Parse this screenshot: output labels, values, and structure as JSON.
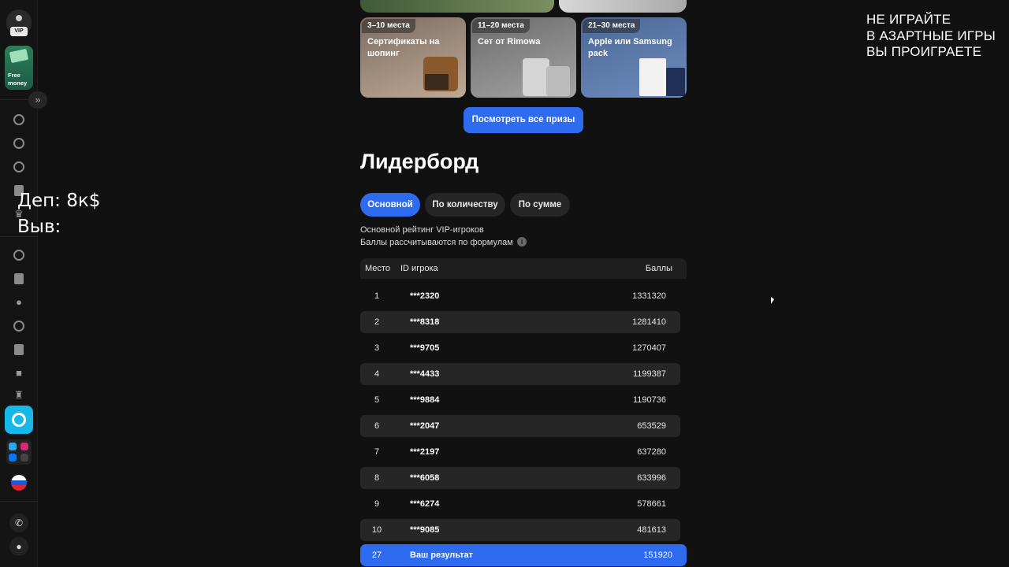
{
  "sidebar": {
    "vip_badge": "VIP",
    "free_money_label": "Free money",
    "icons": [
      "casino-chip-icon",
      "football-icon",
      "coins-icon",
      "gift-icon",
      "crown-icon",
      "compass-icon",
      "document-icon",
      "chat-icon",
      "chart-icon",
      "news-icon",
      "gamepad-icon",
      "trophy-icon",
      "app-icon",
      "social-icon",
      "flag-ru-icon",
      "phone-icon",
      "support-chat-icon"
    ]
  },
  "overlay": {
    "dep_line": "Деп: 8к$",
    "vyv_line": "Выв:",
    "warning_line1": "НЕ ИГРАЙТЕ",
    "warning_line2": "В АЗАРТНЫЕ ИГРЫ",
    "warning_line3": "ВЫ ПРОИГРАЕТЕ"
  },
  "prizes": [
    {
      "badge": "3–10 места",
      "title": "Сертификаты на шопинг"
    },
    {
      "badge": "11–20 места",
      "title": "Сет от Rimowa"
    },
    {
      "badge": "21–30 места",
      "title": "Apple или Samsung pack"
    }
  ],
  "see_all_button": "Посмотреть все призы",
  "leaderboard": {
    "title": "Лидерборд",
    "tabs": [
      "Основной",
      "По количеству",
      "По сумме"
    ],
    "active_tab": "Основной",
    "desc_line1": "Основной рейтинг VIP-игроков",
    "desc_line2": "Баллы рассчитываются по формулам",
    "columns": {
      "place": "Место",
      "id": "ID игрока",
      "points": "Баллы"
    },
    "rows": [
      {
        "place": "1",
        "id": "***2320",
        "points": "1331320"
      },
      {
        "place": "2",
        "id": "***8318",
        "points": "1281410"
      },
      {
        "place": "3",
        "id": "***9705",
        "points": "1270407"
      },
      {
        "place": "4",
        "id": "***4433",
        "points": "1199387"
      },
      {
        "place": "5",
        "id": "***9884",
        "points": "1190736"
      },
      {
        "place": "6",
        "id": "***2047",
        "points": "653529"
      },
      {
        "place": "7",
        "id": "***2197",
        "points": "637280"
      },
      {
        "place": "8",
        "id": "***6058",
        "points": "633996"
      },
      {
        "place": "9",
        "id": "***6274",
        "points": "578661"
      },
      {
        "place": "10",
        "id": "***9085",
        "points": "481613"
      }
    ],
    "my_result": {
      "place": "27",
      "label": "Ваш результат",
      "points": "151920"
    }
  },
  "colors": {
    "accent": "#2f6bef",
    "background": "#111111",
    "active_sidebar": "#17b8e8"
  }
}
